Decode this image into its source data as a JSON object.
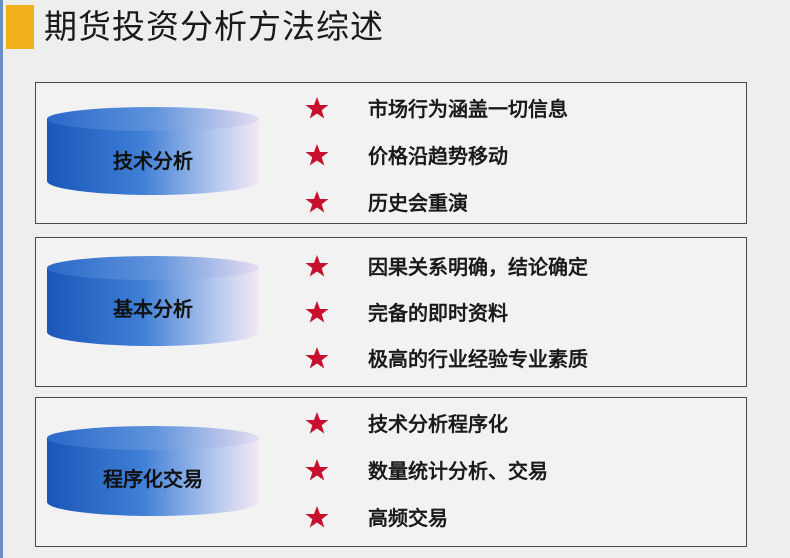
{
  "title": "期货投资分析方法综述",
  "colors": {
    "accent": "#f2b01c",
    "star": "#c8102e",
    "cylinder_blue": "#1f5fbf",
    "cylinder_light": "#f0e6f4"
  },
  "panels": [
    {
      "label": "技术分析",
      "items": [
        "市场行为涵盖一切信息",
        "价格沿趋势移动",
        "历史会重演"
      ]
    },
    {
      "label": "基本分析",
      "items": [
        "因果关系明确，结论确定",
        "完备的即时资料",
        "极高的行业经验专业素质"
      ]
    },
    {
      "label": "程序化交易",
      "items": [
        "技术分析程序化",
        "数量统计分析、交易",
        "高频交易"
      ]
    }
  ],
  "icons": {
    "bullet": "star-icon",
    "shape": "cylinder-icon"
  }
}
